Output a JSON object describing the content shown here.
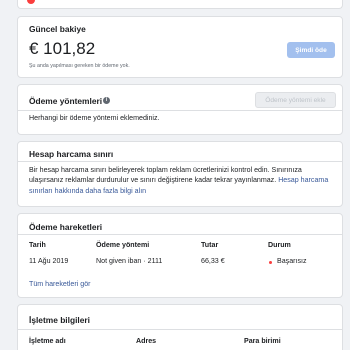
{
  "balance_card": {
    "title": "Güncel bakiye",
    "amount": "€ 101,82",
    "note": "Şu anda yapılması gereken bir ödeme yok.",
    "pay_now_label": "Şimdi öde"
  },
  "payment_methods_card": {
    "title": "Ödeme yöntemleri",
    "add_button_label": "Ödeme yöntemi ekle",
    "empty_text": "Herhangi bir ödeme yöntemi eklemediniz."
  },
  "spending_limit_card": {
    "title": "Hesap harcama sınırı",
    "description": "Bir hesap harcama sınırı belirleyerek toplam reklam ücretlerinizi kontrol edin. Sınırınıza ulaşırsanız reklamlar durdurulur ve sınırı değiştirene kadar tekrar yayınlanmaz. ",
    "learn_more_link": "Hesap harcama sınırları hakkında daha fazla bilgi alın"
  },
  "transactions_card": {
    "title": "Ödeme hareketleri",
    "columns": [
      "Tarih",
      "Ödeme yöntemi",
      "Tutar",
      "Durum"
    ],
    "rows": [
      {
        "date": "11 Ağu 2019",
        "method": "Not given iban · 2111",
        "amount": "66,33 €",
        "status": "Başarısız"
      }
    ],
    "see_all_link": "Tüm hareketleri gör"
  },
  "business_info_card": {
    "title": "İşletme bilgileri",
    "columns": [
      "İşletme adı",
      "Adres",
      "Para birimi"
    ]
  },
  "colors": {
    "accent": "#385898",
    "primary_disabled": "#a3c0ee",
    "failed_status": "#fa3e3e"
  }
}
